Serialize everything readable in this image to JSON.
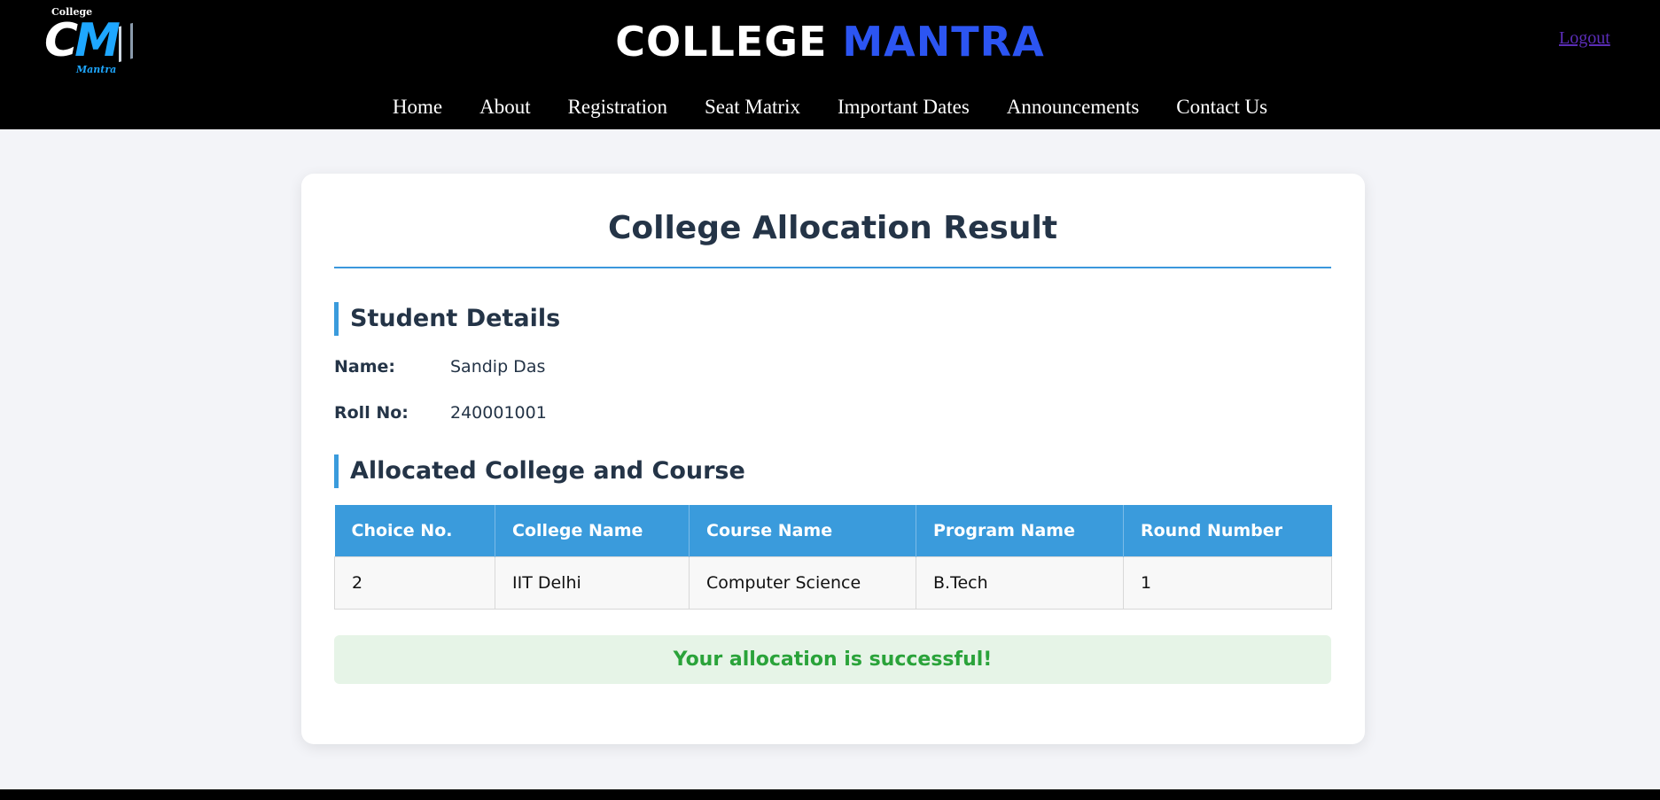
{
  "header": {
    "logo": {
      "small_text": "College",
      "letters": "CM",
      "tagline": "Mantra"
    },
    "brand": {
      "word1": "COLLEGE",
      "word2": "MANTRA"
    },
    "logout_label": "Logout",
    "nav": [
      "Home",
      "About",
      "Registration",
      "Seat Matrix",
      "Important Dates",
      "Announcements",
      "Contact Us"
    ]
  },
  "main": {
    "title": "College Allocation Result",
    "student_section": {
      "heading": "Student Details",
      "name_label": "Name:",
      "name_value": "Sandip Das",
      "roll_label": "Roll No:",
      "roll_value": "240001001"
    },
    "allocation_section": {
      "heading": "Allocated College and Course",
      "columns": [
        "Choice No.",
        "College Name",
        "Course Name",
        "Program Name",
        "Round Number"
      ],
      "rows": [
        [
          "2",
          "IIT Delhi",
          "Computer Science",
          "B.Tech",
          "1"
        ]
      ]
    },
    "status_message": "Your allocation is successful!"
  },
  "colors": {
    "header_bg": "#000000",
    "brand_accent": "#2c55f2",
    "table_header_bg": "#3a9bdc",
    "success_text": "#2aa33a",
    "success_bg": "#e6f4e7"
  }
}
